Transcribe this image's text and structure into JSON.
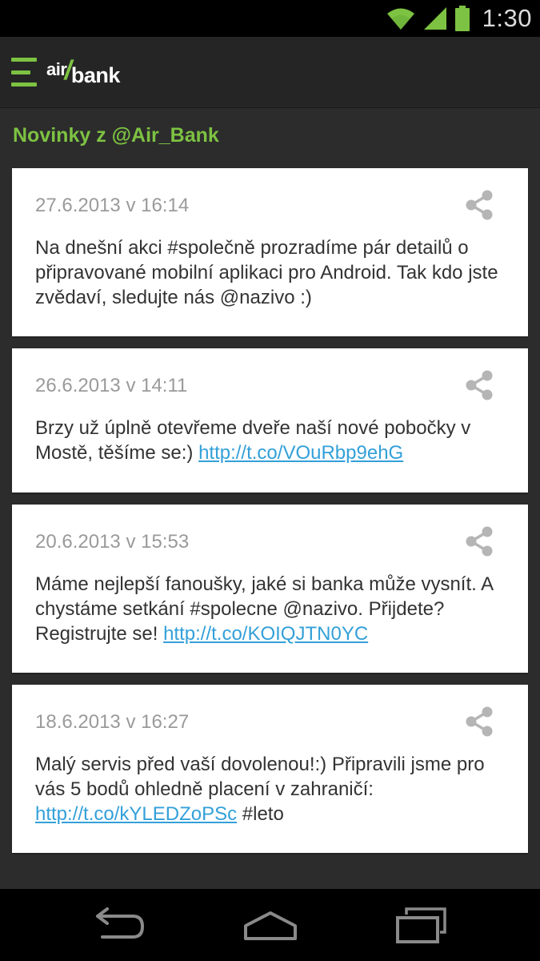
{
  "status_bar": {
    "time": "1:30",
    "icons": [
      "wifi-icon",
      "signal-icon",
      "battery-icon"
    ]
  },
  "app": {
    "logo_air": "air",
    "logo_slash": "/",
    "logo_bank": "bank",
    "menu_icon": "hamburger-menu-icon"
  },
  "colors": {
    "accent": "#7dc242",
    "link": "#33a0d9",
    "background": "#2c2c2c",
    "card": "#ffffff",
    "date_text": "#9a9a9a",
    "body_text": "#333333"
  },
  "section_title": "Novinky z @Air_Bank",
  "posts": [
    {
      "date": "27.6.2013 v 16:14",
      "text": "Na dnešní akci #společně prozradíme pár detailů o připravované mobilní aplikaci pro Android. Tak kdo jste zvědaví, sledujte nás  @nazivo :)",
      "link": "",
      "after_link": ""
    },
    {
      "date": "26.6.2013 v 14:11",
      "text": "Brzy už úplně otevřeme dveře naší nové pobočky v Mostě, těšíme se:) ",
      "link": "http://t.co/VOuRbp9ehG",
      "after_link": ""
    },
    {
      "date": "20.6.2013 v 15:53",
      "text": "Máme nejlepší fanoušky, jaké si banka může vysnít. A chystáme setkání #spolecne @nazivo. Přijdete? Registrujte se! ",
      "link": "http://t.co/KOIQJTN0YC",
      "after_link": ""
    },
    {
      "date": "18.6.2013 v 16:27",
      "text": "Malý servis před vaší dovolenou!:) Připravili jsme pro vás 5 bodů ohledně placení v zahraničí: ",
      "link": "http://t.co/kYLEDZoPSc",
      "after_link": " #leto"
    }
  ],
  "nav_bar": {
    "buttons": [
      "back-icon",
      "home-icon",
      "recent-apps-icon"
    ]
  }
}
